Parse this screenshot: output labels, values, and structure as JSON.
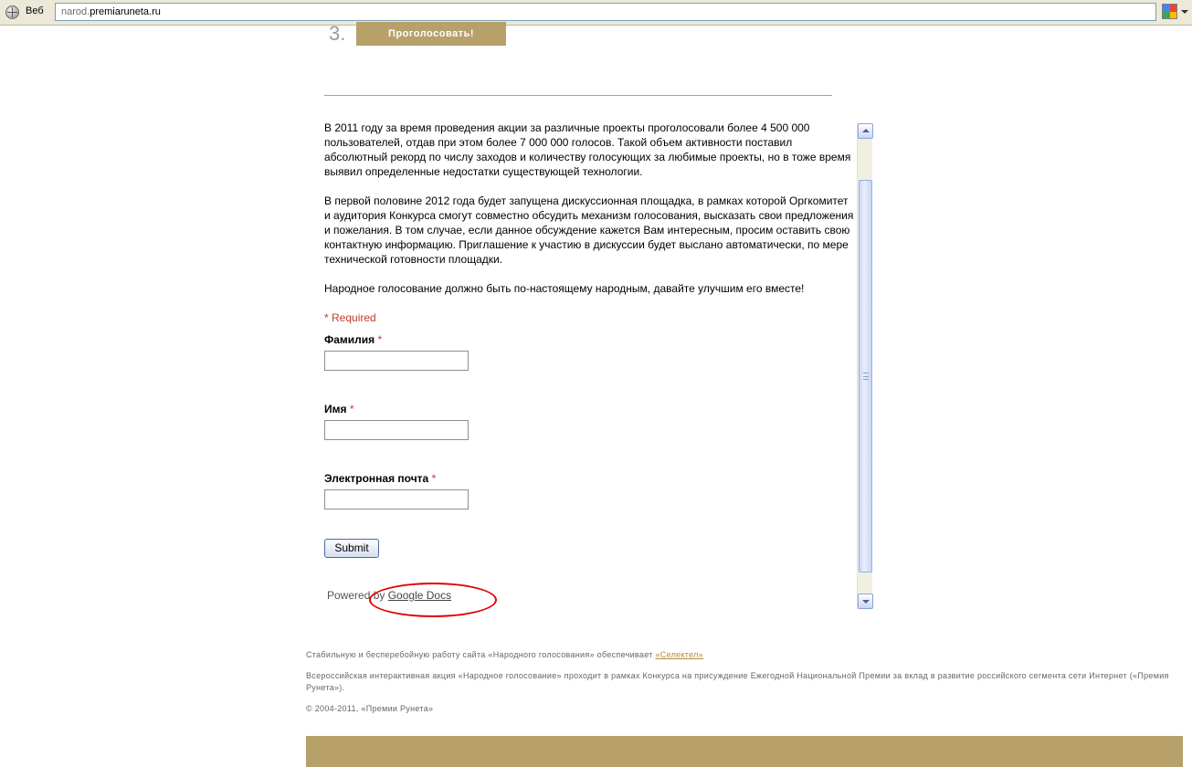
{
  "browser": {
    "web_label": "Веб",
    "address_prefix": "narod.",
    "address_domain": "premiaruneta.ru"
  },
  "vote": {
    "step_number": "3.",
    "button_label": "Проголосовать!"
  },
  "form": {
    "intro_paragraphs": [
      "В 2011 году за время проведения акции за различные проекты проголосовали более 4 500 000 пользователей, отдав при этом более 7 000 000 голосов. Такой объем активности поставил абсолютный рекорд по числу заходов и количеству голосующих за любимые проекты, но в тоже время выявил определенные недостатки существующей технологии.",
      "В первой половине 2012 года будет запущена дискуссионная площадка, в рамках которой Оргкомитет и аудитория Конкурса смогут совместно обсудить механизм голосования, высказать свои предложения и пожелания. В том случае, если данное обсуждение кажется Вам интересным, просим оставить свою контактную информацию. Приглашение к участию в дискуссии будет выслано автоматически, по мере технической готовности площадки.",
      "Народное голосование должно быть по-настоящему народным, давайте улучшим его вместе!"
    ],
    "required_note": "* Required",
    "required_mark": "*",
    "fields": [
      {
        "label": "Фамилия",
        "value": ""
      },
      {
        "label": "Имя",
        "value": ""
      },
      {
        "label": "Электронная почта",
        "value": ""
      }
    ],
    "submit_label": "Submit",
    "powered_prefix": "Powered by",
    "powered_link": "Google Docs"
  },
  "footer": {
    "line1_text": "Стабильную и бесперебойную работу сайта «Народного голосования» обеспечивает",
    "line1_link": "«Селектел»",
    "line2": "Всероссийская интерактивная акция «Народное голосование» проходит в рамках Конкурса на присуждение Ежегодной Национальной Премии за вклад в развитие российского сегмента сети Интернет («Премия Рунета»).",
    "copyright": "© 2004-2011, «Премии Рунета»"
  },
  "colors": {
    "gold": "#b8a06a",
    "required_red": "#c0392b",
    "annotation_red": "#e00000"
  },
  "icons": {
    "site": "globe-icon",
    "toolbar": "google-toolbar-icon",
    "scroll_up": "scroll-up-arrow-icon",
    "scroll_down": "scroll-down-arrow-icon"
  }
}
